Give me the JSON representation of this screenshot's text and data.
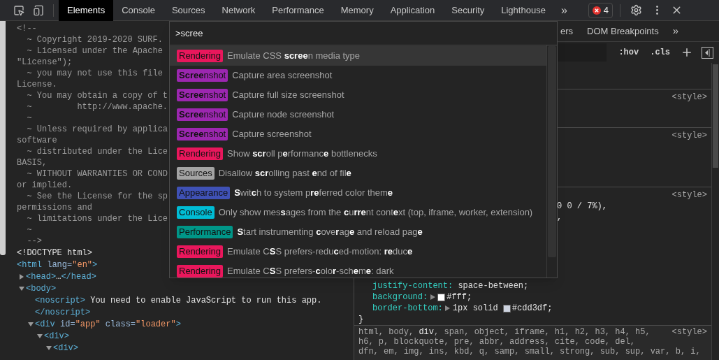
{
  "toolbar": {
    "tabs": [
      {
        "label": "Elements",
        "selected": true
      },
      {
        "label": "Console",
        "selected": false
      },
      {
        "label": "Sources",
        "selected": false
      },
      {
        "label": "Network",
        "selected": false
      },
      {
        "label": "Performance",
        "selected": false
      },
      {
        "label": "Memory",
        "selected": false
      },
      {
        "label": "Application",
        "selected": false
      },
      {
        "label": "Security",
        "selected": false
      },
      {
        "label": "Lighthouse",
        "selected": false
      }
    ],
    "overflow": "»",
    "error_count": "4"
  },
  "elements": {
    "comment": [
      "<!--",
      "  ~ Copyright 2019-2020 SURF.",
      "  ~ Licensed under the Apache",
      "\"License\");",
      "  ~ you may not use this file",
      "License.",
      "  ~ You may obtain a copy of t",
      "  ~         http://www.apache.",
      "  ~",
      "  ~ Unless required by applica",
      "software",
      "  ~ distributed under the Lice",
      "BASIS,",
      "  ~ WITHOUT WARRANTIES OR COND",
      "or implied.",
      "  ~ See the License for the sp",
      "permissions and",
      "  ~ limitations under the Lice",
      "  ~",
      "  -->"
    ],
    "tree": [
      {
        "segments": [
          {
            "kind": "text",
            "text": "<!DOCTYPE html>"
          }
        ]
      },
      {
        "segments": [
          {
            "kind": "tag",
            "text": "<html "
          },
          {
            "kind": "attr",
            "text": "lang="
          },
          {
            "kind": "value",
            "text": "\"en\""
          },
          {
            "kind": "tag",
            "text": ">"
          }
        ],
        "children": [
          {
            "expanded": false,
            "segments": [
              {
                "kind": "tag",
                "text": "<head>"
              },
              {
                "kind": "text",
                "text": "…"
              },
              {
                "kind": "tag",
                "text": "</head>"
              }
            ]
          },
          {
            "expanded": true,
            "segments": [
              {
                "kind": "tag",
                "text": "<body>"
              }
            ],
            "children": [
              {
                "segments": [
                  {
                    "kind": "tag",
                    "text": "<noscript>"
                  },
                  {
                    "kind": "text",
                    "text": " You need to enable JavaScript to run this app."
                  }
                ]
              },
              {
                "segments": [
                  {
                    "kind": "tag",
                    "text": "</noscript>"
                  }
                ]
              },
              {
                "expanded": true,
                "segments": [
                  {
                    "kind": "tag",
                    "text": "<div "
                  },
                  {
                    "kind": "attr",
                    "text": "id="
                  },
                  {
                    "kind": "value",
                    "text": "\"app\""
                  },
                  {
                    "kind": "attr",
                    "text": " class="
                  },
                  {
                    "kind": "value",
                    "text": "\"loader\""
                  },
                  {
                    "kind": "tag",
                    "text": ">"
                  }
                ],
                "children": [
                  {
                    "expanded": true,
                    "segments": [
                      {
                        "kind": "tag",
                        "text": "<div>"
                      }
                    ],
                    "children": [
                      {
                        "expanded": true,
                        "segments": [
                          {
                            "kind": "tag",
                            "text": "<div>"
                          }
                        ]
                      }
                    ]
                  }
                ]
              }
            ]
          }
        ]
      }
    ]
  },
  "styles": {
    "subtabs": [
      "ers",
      "DOM Breakpoints"
    ],
    "overflow": "»",
    "hov": ":hov",
    "cls": ".cls",
    "sections": [
      {
        "kind": "inline"
      },
      {
        "kind": "rule",
        "source": "<style>"
      },
      {
        "kind": "rule",
        "source": "<style>"
      },
      {
        "kind": "rule",
        "source": "<style>",
        "fragments": [
          "0 0 / 7%),",
          ","
        ],
        "declarations": [
          {
            "property": "justify-content:",
            "value": " space-between;"
          },
          {
            "property": "background:",
            "expanded": false,
            "color": "#ffffff",
            "value": "#fff;"
          },
          {
            "property": "border-bottom:",
            "expanded": false,
            "value": "1px solid ",
            "color": "#cdd3df",
            "value_after": "#cdd3df;"
          }
        ],
        "close": "}"
      }
    ],
    "selector": {
      "source": "<style>",
      "lines": [
        "html, body, **div**, span, object, iframe, h1, h2, h3, h4, h5,",
        "h6, p, blockquote, pre, abbr, address, cite, code, del,",
        "dfn, em, img, ins, kbd, q, samp, small, strong, sub, sup, var, b, i,"
      ]
    }
  },
  "command_menu": {
    "query": ">scree",
    "items": [
      {
        "category": "Rendering",
        "color": "#e9175c",
        "label": "Emulate CSS **scree**n media type",
        "selected": true
      },
      {
        "category": "**Scree**nshot",
        "color": "#9c27b0",
        "label": "Capture area screenshot",
        "selected": false
      },
      {
        "category": "**Scree**nshot",
        "color": "#9c27b0",
        "label": "Capture full size screenshot",
        "selected": false
      },
      {
        "category": "**Scree**nshot",
        "color": "#9c27b0",
        "label": "Capture node screenshot",
        "selected": false
      },
      {
        "category": "**Scree**nshot",
        "color": "#9c27b0",
        "label": "Capture screenshot",
        "selected": false
      },
      {
        "category": "Rendering",
        "color": "#e9175c",
        "label": "Show **scr**oll p**e**rformanc**e** bottlenecks",
        "selected": false
      },
      {
        "category": "Sources",
        "color": "#a3a3a3",
        "label": "Disallow **scr**olling past **e**nd of fil**e**",
        "selected": false
      },
      {
        "category": "Appearance",
        "color": "#3f51b5",
        "label": "**S**wit**c**h to system p**re**ferred color them**e**",
        "selected": false
      },
      {
        "category": "Console",
        "color": "#00bcd4",
        "label": "Only show mes**s**ages from the **c**u**rre**nt cont**e**xt (top, iframe, worker, extension)",
        "selected": false
      },
      {
        "category": "Performance",
        "color": "#009688",
        "label": "**S**tart instrumenting **c**ove**r**ag**e** and reload pag**e**",
        "selected": false
      },
      {
        "category": "Rendering",
        "color": "#e9175c",
        "label": "Emulate C**S**S prefers-redu**c**ed-motion: **re**duc**e**",
        "selected": false
      },
      {
        "category": "Rendering",
        "color": "#e9175c",
        "label": "Emulate C**S**S prefers-**c**olo**r**-sch**e**m**e**: dark",
        "selected": false
      }
    ]
  }
}
